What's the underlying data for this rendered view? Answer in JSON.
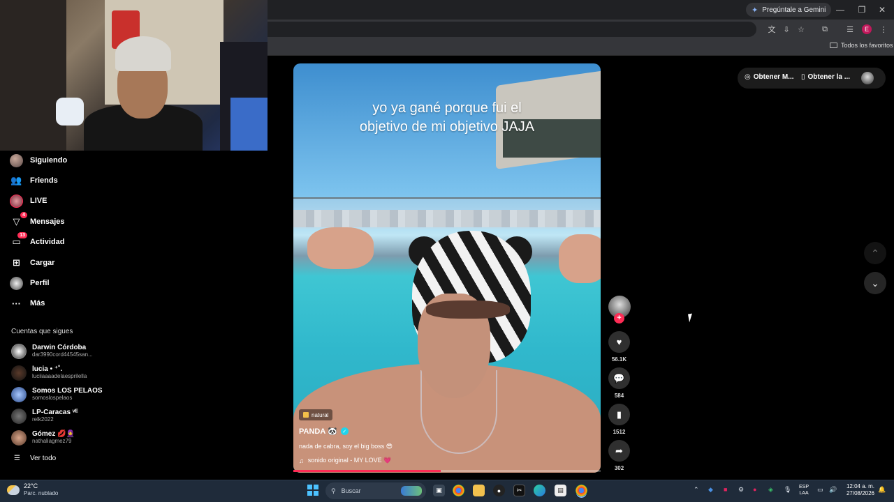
{
  "browser": {
    "gemini_label": "Pregúntale a Gemini",
    "favorites_label": "Todos los favoritos",
    "profile_initial": "E"
  },
  "sidebar": {
    "items": [
      {
        "label": "Siguiendo",
        "icon": "avatar",
        "badge": ""
      },
      {
        "label": "Friends",
        "icon": "friends-icon",
        "badge": ""
      },
      {
        "label": "LIVE",
        "icon": "live-avatar",
        "badge": ""
      },
      {
        "label": "Mensajes",
        "icon": "messages-icon",
        "badge": "4"
      },
      {
        "label": "Actividad",
        "icon": "activity-icon",
        "badge": "13"
      },
      {
        "label": "Cargar",
        "icon": "upload-icon",
        "badge": ""
      },
      {
        "label": "Perfil",
        "icon": "profile-avatar",
        "badge": ""
      },
      {
        "label": "Más",
        "icon": "more-icon",
        "badge": ""
      }
    ],
    "following_title": "Cuentas que sigues",
    "accounts": [
      {
        "name": "Darwin Córdoba",
        "handle": "dar3990cord44545san..."
      },
      {
        "name": "lucia • ⁺˚.",
        "handle": "luciiaaaadelaesprilella"
      },
      {
        "name": "Somos LOS PELAOS",
        "handle": "somoslospelaos"
      },
      {
        "name": "LP-Caracas ᵛᴱ",
        "handle": "relk2022"
      },
      {
        "name": "Gómez 💋🧕",
        "handle": "nathaliagmez79"
      }
    ],
    "see_all": "Ver todo"
  },
  "video": {
    "caption_line1": "yo ya gané porque fui el",
    "caption_line2": "objetivo de mi objetivo JAJA",
    "tag": "natural",
    "author": "PANDA 🐼",
    "description": "nada de cabra, soy el big boss 😎",
    "music": "sonido original - MY LOVE 💗",
    "progress": 0.48
  },
  "actions": {
    "likes": "56.1K",
    "comments": "584",
    "saves": "1512",
    "shares": "302"
  },
  "top_right": {
    "get_app1": "Obtener M...",
    "get_app2": "Obtener la ..."
  },
  "taskbar": {
    "temperature": "22°C",
    "weather": "Parc. nublado",
    "search_placeholder": "Buscar",
    "lang_line1": "ESP",
    "lang_line2": "LAA",
    "time": "12:04 a. m.",
    "date": "27/08/2026"
  },
  "colors": {
    "accent": "#fe2c55",
    "verified": "#20d5ec",
    "taskbar": "#1f2b3a"
  }
}
